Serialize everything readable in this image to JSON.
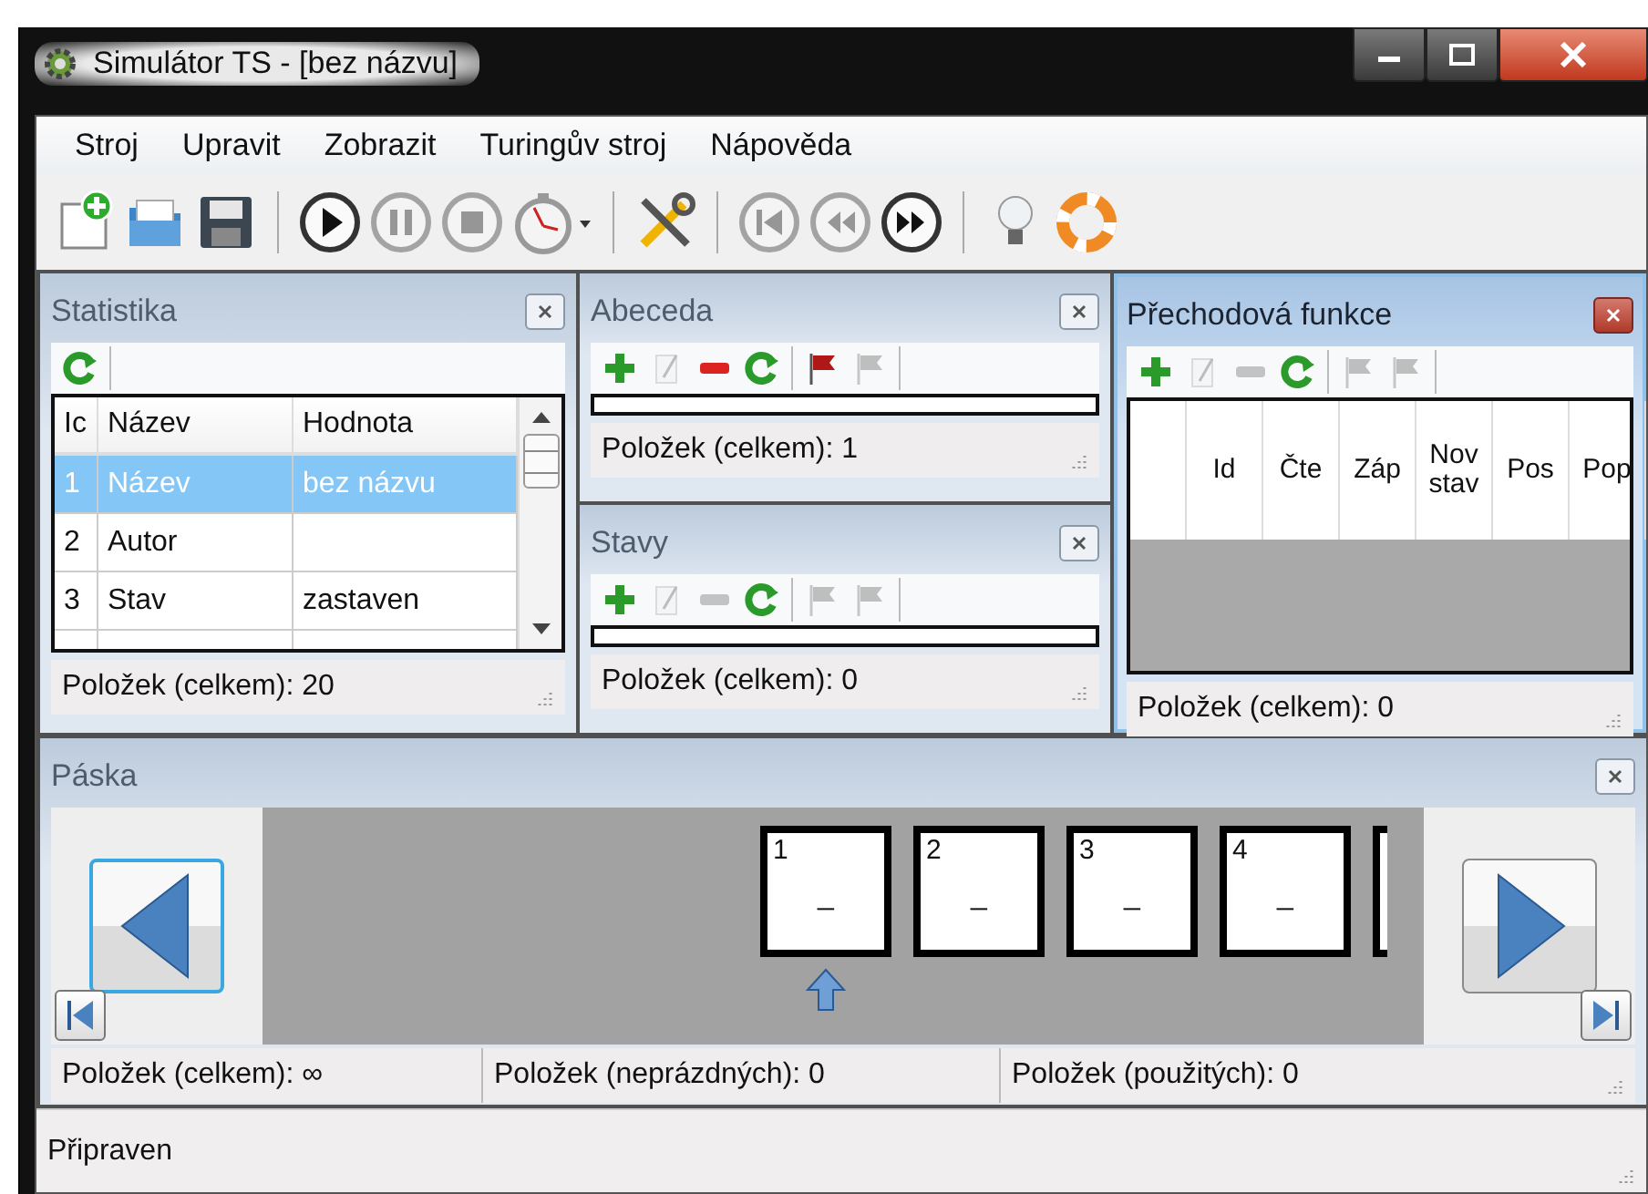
{
  "window": {
    "title": "Simulátor TS - [bez názvu]"
  },
  "menu": [
    "Stroj",
    "Upravit",
    "Zobrazit",
    "Turingův stroj",
    "Nápověda"
  ],
  "toolbar": [
    [
      {
        "kind": "new",
        "disabled": false
      },
      {
        "kind": "open",
        "disabled": false
      },
      {
        "kind": "save",
        "disabled": false
      }
    ],
    [
      {
        "kind": "play",
        "disabled": false
      },
      {
        "kind": "pause",
        "disabled": true
      },
      {
        "kind": "stop",
        "disabled": true
      },
      {
        "kind": "timer",
        "disabled": false
      }
    ],
    [
      {
        "kind": "tools",
        "disabled": false
      }
    ],
    [
      {
        "kind": "first",
        "disabled": true
      },
      {
        "kind": "back",
        "disabled": true
      },
      {
        "kind": "forward",
        "disabled": false
      }
    ],
    [
      {
        "kind": "bulb",
        "disabled": false
      },
      {
        "kind": "help",
        "disabled": false
      }
    ]
  ],
  "statistika": {
    "title": "Statistika",
    "tools": [
      {
        "kind": "refresh",
        "disabled": false
      }
    ],
    "columns": [
      "Ic",
      "Název",
      "Hodnota"
    ],
    "rows": [
      {
        "id": "1",
        "name": "Název",
        "value": "bez názvu",
        "selected": true
      },
      {
        "id": "2",
        "name": "Autor",
        "selected": false
      },
      {
        "id": "3",
        "name": "Stav",
        "value": "zastaven",
        "selected": false
      }
    ],
    "status": "Položek (celkem): 20"
  },
  "abeceda": {
    "title": "Abeceda",
    "tools": [
      {
        "kind": "add",
        "disabled": false
      },
      {
        "kind": "edit",
        "disabled": true
      },
      {
        "kind": "remove",
        "disabled": false
      },
      {
        "kind": "refresh",
        "disabled": false
      },
      {
        "kind": "flag",
        "disabled": false
      },
      {
        "kind": "flag",
        "disabled": true
      }
    ],
    "status": "Položek (celkem): 1"
  },
  "stavy": {
    "title": "Stavy",
    "tools": [
      {
        "kind": "add",
        "disabled": false
      },
      {
        "kind": "edit",
        "disabled": true
      },
      {
        "kind": "remove",
        "disabled": true
      },
      {
        "kind": "refresh",
        "disabled": false
      },
      {
        "kind": "flag",
        "disabled": true
      },
      {
        "kind": "flag",
        "disabled": true
      }
    ],
    "status": "Položek (celkem): 0"
  },
  "prechodova_funkce": {
    "title": "Přechodová funkce",
    "active": true,
    "tools": [
      {
        "kind": "add",
        "disabled": false
      },
      {
        "kind": "edit",
        "disabled": true
      },
      {
        "kind": "remove",
        "disabled": true
      },
      {
        "kind": "refresh",
        "disabled": false
      },
      {
        "kind": "flag",
        "disabled": true
      },
      {
        "kind": "flag",
        "disabled": true
      }
    ],
    "columns": [
      "Id",
      "Čte",
      "Záp",
      "Nov stav",
      "Pos",
      "Pop"
    ],
    "status": "Položek (celkem): 0"
  },
  "paska": {
    "title": "Páska",
    "cells": [
      {
        "index": "1",
        "symbol": "_",
        "head": true
      },
      {
        "index": "2",
        "symbol": "_",
        "head": false
      },
      {
        "index": "3",
        "symbol": "_",
        "head": false
      },
      {
        "index": "4",
        "symbol": "_",
        "head": false
      }
    ],
    "status": [
      "Položek (celkem): ∞",
      "Položek (neprázdných): 0",
      "Položek (použitých): 0"
    ]
  },
  "status_bar": "Připraven"
}
